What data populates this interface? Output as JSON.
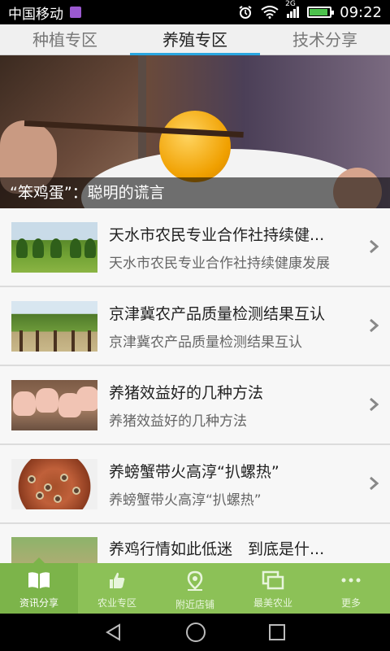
{
  "status_bar": {
    "carrier": "中国移动",
    "network": "2G",
    "time": "09:22",
    "battery_level": 0.85
  },
  "tabs": [
    {
      "label": "种植专区",
      "active": false
    },
    {
      "label": "养殖专区",
      "active": true
    },
    {
      "label": "技术分享",
      "active": false
    }
  ],
  "banner": {
    "caption": "“笨鸡蛋”：聪明的谎言"
  },
  "articles": [
    {
      "title": "天水市农民专业合作社持续健...",
      "subtitle": "天水市农民专业合作社持续健康发展",
      "thumb": "farm-field-image"
    },
    {
      "title": "京津冀农产品质量检测结果互认",
      "subtitle": "京津冀农产品质量检测结果互认",
      "thumb": "orchard-image"
    },
    {
      "title": "养猪效益好的几种方法",
      "subtitle": "养猪效益好的几种方法",
      "thumb": "pigs-image"
    },
    {
      "title": "养螃蟹带火高淳“扒螺热”",
      "subtitle": "养螃蟹带火高淳“扒螺热”",
      "thumb": "snails-dish-image"
    },
    {
      "title": "养鸡行情如此低迷　到底是什...",
      "subtitle": "",
      "thumb": "chickens-image"
    }
  ],
  "bottom_nav": [
    {
      "label": "资讯分享",
      "icon": "book-icon",
      "active": true
    },
    {
      "label": "农业专区",
      "icon": "thumbs-up-icon",
      "active": false
    },
    {
      "label": "附近店铺",
      "icon": "location-pin-icon",
      "active": false
    },
    {
      "label": "最美农业",
      "icon": "stacked-windows-icon",
      "active": false
    },
    {
      "label": "更多",
      "icon": "more-dots-icon",
      "active": false
    }
  ],
  "colors": {
    "tab_indicator": "#2aa6e0",
    "bottom_nav_bg": "#8cc157",
    "bottom_nav_active": "#7cb44a"
  }
}
